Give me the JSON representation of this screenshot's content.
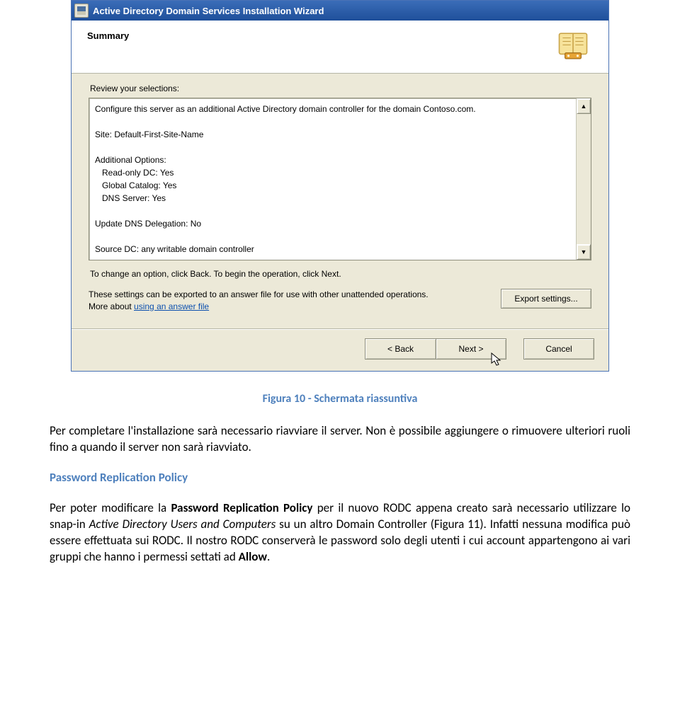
{
  "wizard": {
    "window_title": "Active Directory Domain Services Installation Wizard",
    "banner_title": "Summary",
    "review_label": "Review your selections:",
    "selections_text": "Configure this server as an additional Active Directory domain controller for the domain Contoso.com.\n\nSite: Default-First-Site-Name\n\nAdditional Options:\n   Read-only DC: Yes\n   Global Catalog: Yes\n   DNS Server: Yes\n\nUpdate DNS Delegation: No\n\nSource DC: any writable domain controller",
    "instruction": "To change an option, click Back. To begin the operation, click Next.",
    "export_text": "These settings can be exported to an answer file for use with other unattended operations.",
    "more_about_prefix": "More about ",
    "more_about_link": "using an answer file",
    "export_button": "Export settings...",
    "back_button": "< Back",
    "next_button": "Next >",
    "cancel_button": "Cancel",
    "scroll_up": "▲",
    "scroll_down": "▼"
  },
  "doc": {
    "caption": "Figura 10  -  Schermata riassuntiva",
    "p1": "Per completare l'installazione sarà necessario riavviare il server. Non è possibile aggiungere o rimuovere ulteriori ruoli fino a quando il server non sarà riavviato.",
    "heading": "Password Replication Policy",
    "p2_a": "Per poter modificare la ",
    "p2_policy": "Password Replication Policy",
    "p2_b": " per il nuovo RODC appena creato sarà necessario utilizzare lo snap-in ",
    "p2_snapin": "Active Directory Users and Computers",
    "p2_c": " su un altro Domain Controller (Figura 11). Infatti nessuna modifica può essere effettuata sui RODC. Il nostro RODC conserverà le password solo degli utenti i cui account appartengono ai vari gruppi che hanno i permessi settati ad ",
    "p2_allow": "Allow",
    "p2_d": "."
  }
}
